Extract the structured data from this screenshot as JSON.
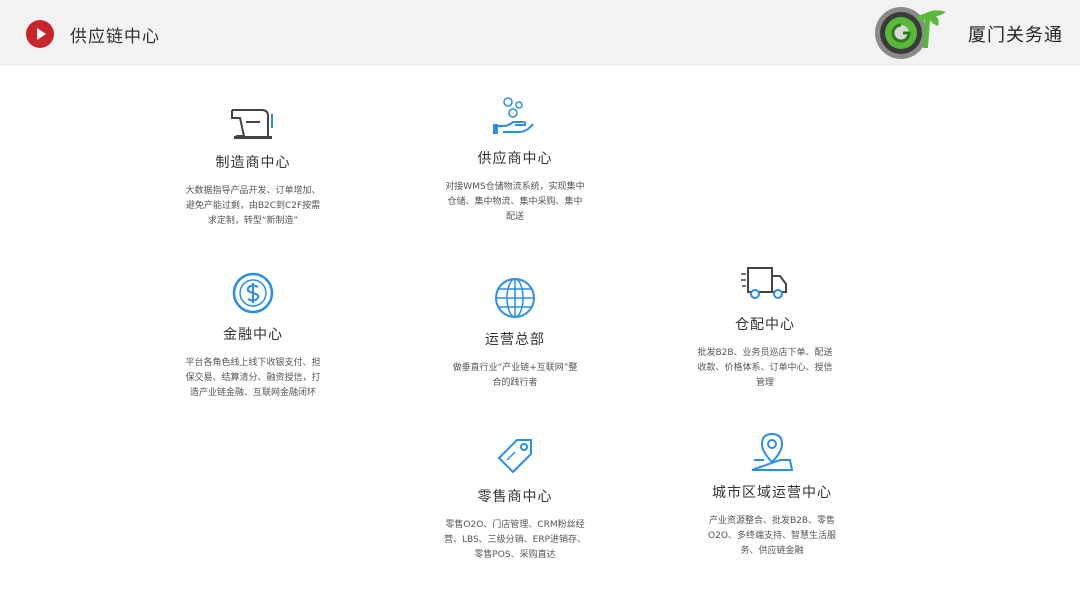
{
  "header": {
    "title": "供应链中心",
    "company": "厦门关务通",
    "accent_color": "#c8262c",
    "icon": "play-icon"
  },
  "cards": {
    "manufacturer": {
      "icon": "sewing-machine-icon",
      "title": "制造商中心",
      "desc": [
        "大数据指导产品开发、订单增加、",
        "避免产能过剩，由B2C到C2F按需",
        "求定制，转型“新制造”"
      ]
    },
    "supplier": {
      "icon": "hand-bubbles-icon",
      "title": "供应商中心",
      "desc": [
        "对接WMS仓储物流系统，实现集中",
        "仓储、集中物流、集中采购、集中",
        "配送"
      ]
    },
    "finance": {
      "icon": "dollar-coin-icon",
      "title": "金融中心",
      "desc": [
        "平台各角色线上线下收银支付、担",
        "保交易、结算清分、融资授信，打",
        "造产业链金融、互联网金融闭环"
      ]
    },
    "operations": {
      "icon": "globe-icon",
      "title": "运营总部",
      "desc": [
        "做垂直行业“产业链+互联网”整",
        "合的践行者"
      ]
    },
    "warehouse": {
      "icon": "delivery-truck-icon",
      "title": "仓配中心",
      "desc": [
        "批发B2B、业务员巡店下单、配送",
        "收款、价格体系、订单中心、授信",
        "管理"
      ]
    },
    "retail": {
      "icon": "price-tag-icon",
      "title": "零售商中心",
      "desc": [
        "零售O2O、门店管理、CRM粉丝经",
        "营、LBS、三级分销、ERP进销存、",
        "零售POS、采购直达"
      ]
    },
    "city": {
      "icon": "map-pin-icon",
      "title": "城市区域运营中心",
      "desc": [
        "产业资源整合、批发B2B、零售",
        "O2O、多终端支持、智慧生活服",
        "务、供应链金融"
      ]
    }
  },
  "icon_color": "#2a8ee8"
}
